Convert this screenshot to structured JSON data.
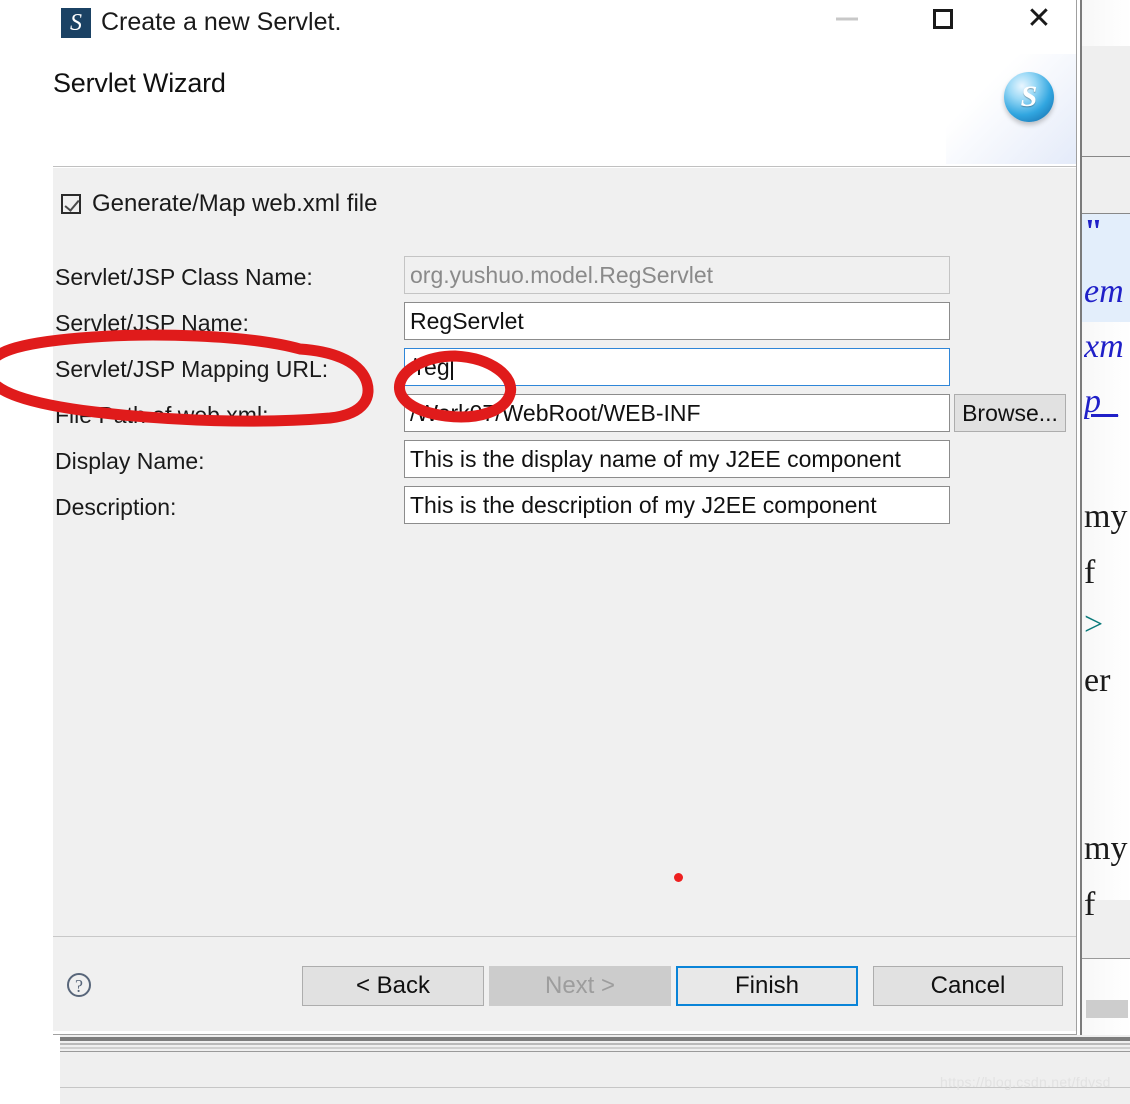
{
  "window": {
    "title": "Create a new Servlet.",
    "icon": "servlet-app-icon",
    "controls": {
      "minimize": "minimize-icon",
      "maximize": "maximize-icon",
      "close": "close-icon"
    }
  },
  "wizard": {
    "heading": "Servlet Wizard",
    "banner_icon": "S"
  },
  "options": {
    "generate_webxml_label": "Generate/Map web.xml file",
    "generate_webxml_checked": true
  },
  "form": {
    "rows": [
      {
        "label": "Servlet/JSP Class Name:",
        "value": "org.yushuo.model.RegServlet",
        "state": "disabled"
      },
      {
        "label": "Servlet/JSP Name:",
        "value": "RegServlet",
        "state": "normal"
      },
      {
        "label": "Servlet/JSP Mapping URL:",
        "value": "/reg",
        "state": "focused"
      },
      {
        "label": "File Path of web.xml:",
        "value": "/Work07/WebRoot/WEB-INF",
        "state": "normal"
      },
      {
        "label": "Display Name:",
        "value": "This is the display name of my J2EE component",
        "state": "normal"
      },
      {
        "label": "Description:",
        "value": "This is the description of my J2EE component",
        "state": "normal"
      }
    ],
    "browse_label": "Browse..."
  },
  "footer": {
    "help_icon": "?",
    "buttons": [
      {
        "label": "< Back",
        "state": "normal"
      },
      {
        "label": "Next >",
        "state": "disabled"
      },
      {
        "label": "Finish",
        "state": "default"
      },
      {
        "label": "Cancel",
        "state": "normal"
      }
    ]
  },
  "annotations": {
    "color": "#e01b1b",
    "ellipse_label": "ellipse around Servlet/JSP Mapping URL label",
    "ellipse_value": "ellipse around /reg value",
    "dot": "red-dot-mark"
  },
  "background_editor": {
    "code_fragments": [
      "\"",
      "em",
      "xm",
      "p_",
      "my",
      "f",
      ">",
      "er",
      "my",
      "f"
    ]
  },
  "watermark": "https://blog.csdn.net/fdvsd"
}
